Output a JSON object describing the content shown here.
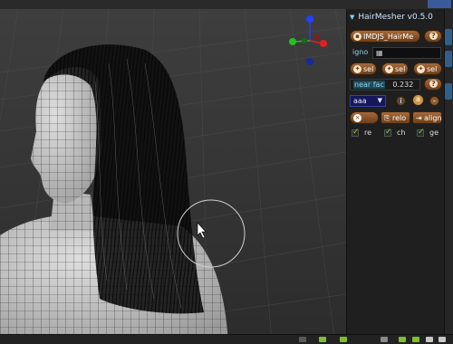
{
  "app": {
    "panel_title": "HairMesher v0.5.0"
  },
  "panel": {
    "file_button": "IMDJS_HairMe",
    "ignore_label": "igno",
    "sel_buttons": [
      "sel",
      "sel",
      "sel"
    ],
    "near_fac_label": "near fac",
    "near_fac_value": "0.232",
    "mode_select": "aaa",
    "reload_label": "relo",
    "align_label": "align",
    "checks": [
      "re",
      "ch",
      "ge"
    ]
  },
  "colors": {
    "accent_button": "#8a5530",
    "panel_bg": "#1f1f1f",
    "label_teal": "#8fd3e8",
    "select_bg": "#14185a",
    "check_green": "#7ee01a",
    "gizmo_x": "#e02020",
    "gizmo_y": "#20c020",
    "gizmo_z": "#2040ff"
  },
  "icons": [
    "help-icon",
    "image-icon",
    "close-icon",
    "reload-icon",
    "align-icon",
    "info-icon",
    "add-icon",
    "remove-icon",
    "hair-icon"
  ]
}
